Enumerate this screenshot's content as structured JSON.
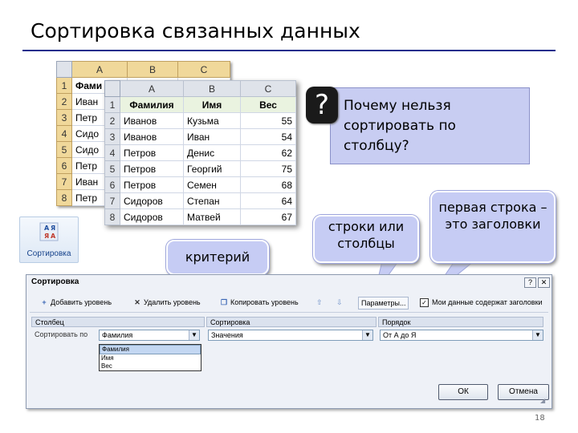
{
  "slide": {
    "title": "Сортировка связанных данных",
    "page_number": "18",
    "accent_color": "#1c2d8c"
  },
  "back_sheet": {
    "columns": [
      "A",
      "B",
      "C"
    ],
    "rows": [
      {
        "n": "1",
        "a": "Фами"
      },
      {
        "n": "2",
        "a": "Иван"
      },
      {
        "n": "3",
        "a": "Петр"
      },
      {
        "n": "4",
        "a": "Сидо"
      },
      {
        "n": "5",
        "a": "Сидо"
      },
      {
        "n": "6",
        "a": "Петр"
      },
      {
        "n": "7",
        "a": "Иван"
      },
      {
        "n": "8",
        "a": "Петр"
      }
    ]
  },
  "front_sheet": {
    "columns": [
      "A",
      "B",
      "C"
    ],
    "header": {
      "n": "1",
      "a": "Фамилия",
      "b": "Имя",
      "c": "Вес"
    },
    "rows": [
      {
        "n": "2",
        "a": "Иванов",
        "b": "Кузьма",
        "c": "55"
      },
      {
        "n": "3",
        "a": "Иванов",
        "b": "Иван",
        "c": "54"
      },
      {
        "n": "4",
        "a": "Петров",
        "b": "Денис",
        "c": "62"
      },
      {
        "n": "5",
        "a": "Петров",
        "b": "Георгий",
        "c": "75"
      },
      {
        "n": "6",
        "a": "Петров",
        "b": "Семен",
        "c": "68"
      },
      {
        "n": "7",
        "a": "Сидоров",
        "b": "Степан",
        "c": "64"
      },
      {
        "n": "8",
        "a": "Сидоров",
        "b": "Матвей",
        "c": "67"
      }
    ]
  },
  "sort_button": {
    "label": "Сортировка",
    "icon": "sort-az-icon",
    "icon_glyph": "А Я\nЯ А"
  },
  "question": {
    "mark": "?",
    "text": "Почему нельзя сортировать по столбцу?"
  },
  "callouts": {
    "criterion": "критерий",
    "rows_or_columns": "строки или столбцы",
    "first_row_header": "первая строка – это заголовки"
  },
  "dialog": {
    "title": "Сортировка",
    "help": "?",
    "close": "✕",
    "toolbar": {
      "add": "Добавить уровень",
      "delete": "Удалить уровень",
      "copy": "Копировать уровень",
      "up": "⇧",
      "down": "⇩",
      "params": "Параметры...",
      "header_checkbox": "Мои данные содержат заголовки",
      "header_checked": true
    },
    "column_headers": {
      "column": "Столбец",
      "sort_on": "Сортировка",
      "order": "Порядок"
    },
    "row_label": "Сортировать по",
    "column_value": "Фамилия",
    "sort_on_value": "Значения",
    "order_value": "От А до Я",
    "dropdown_options": [
      "Фамилия",
      "Имя",
      "Вес"
    ],
    "ok": "ОК",
    "cancel": "Отмена"
  }
}
